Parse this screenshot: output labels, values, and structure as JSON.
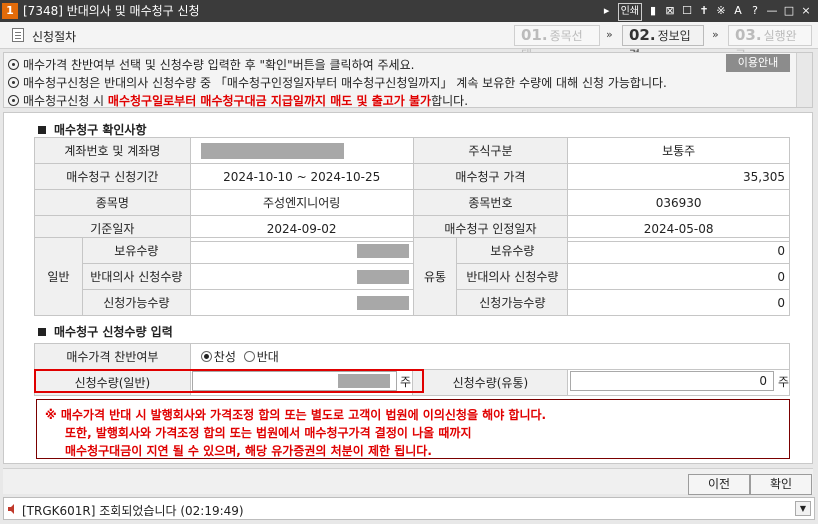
{
  "window": {
    "number": "1",
    "title": "[7348] 반대의사 및 매수청구 신청",
    "tools": [
      "▸",
      "인쇄",
      "▮",
      "⊠",
      "☐",
      "✝",
      "※",
      "A",
      "?",
      "—",
      "□",
      "×"
    ]
  },
  "steps": {
    "section_label": "신청절차",
    "items": [
      {
        "num": "01.",
        "label": "종목선택",
        "active": false
      },
      {
        "num": "02.",
        "label": "정보입력",
        "active": true
      },
      {
        "num": "03.",
        "label": "실행완료",
        "active": false
      }
    ],
    "arrow": "»"
  },
  "info": {
    "line1": "매수가격 찬반여부 선택 및 신청수량 입력한 후 \"확인\"버튼을 클릭하여 주세요.",
    "line2": "매수청구신청은 반대의사 신청수량 중 「매수청구인정일자부터 매수청구신청일까지」 계속 보유한 수량에 대해 신청 가능합니다.",
    "line3_pre": "매수청구신청 시 ",
    "line3_red": "매수청구일로부터 매수청구대금 지급일까지 매도 및 출고가 불가",
    "line3_post": "합니다.",
    "usage_button": "이용안내"
  },
  "confirm_section": {
    "title": "매수청구 확인사항",
    "account_label": "계좌번호 및 계좌명",
    "stock_type_label": "주식구분",
    "stock_type_value": "보통주",
    "period_label": "매수청구 신청기간",
    "period_value": "2024-10-10  ~  2024-10-25",
    "price_label": "매수청구 가격",
    "price_value": "35,305",
    "name_label": "종목명",
    "name_value": "주성엔지니어링",
    "code_label": "종목번호",
    "code_value": "036930",
    "base_date_label": "기준일자",
    "base_date_value": "2024-09-02",
    "recognize_label": "매수청구 인정일자",
    "recognize_value": "2024-05-08",
    "general_label": "일반",
    "flow_label": "유통",
    "hold_label": "보유수량",
    "oppose_label": "반대의사 신청수량",
    "avail_label": "신청가능수량",
    "flow_hold": "0",
    "flow_oppose": "0",
    "flow_avail": "0"
  },
  "input_section": {
    "title": "매수청구 신청수량 입력",
    "vote_label": "매수가격 찬반여부",
    "agree": "찬성",
    "disagree": "반대",
    "qty_general_label": "신청수량(일반)",
    "qty_flow_label": "신청수량(유통)",
    "unit": "주",
    "qty_flow_value": "0"
  },
  "warning": {
    "line1": "※ 매수가격 반대 시 발행회사와 가격조정 합의 또는 별도로 고객이 법원에 이의신청을 해야 합니다.",
    "line2": "또한, 발행회사와 가격조정 합의 또는 법원에서 매수청구가격 결정이 나올 때까지",
    "line3": "매수청구대금이 지연 될 수 있으며, 해당 유가증권의 처분이 제한 됩니다."
  },
  "buttons": {
    "prev": "이전",
    "confirm": "확인"
  },
  "status": {
    "message": "[TRGK601R] 조회되었습니다 (02:19:49)"
  }
}
